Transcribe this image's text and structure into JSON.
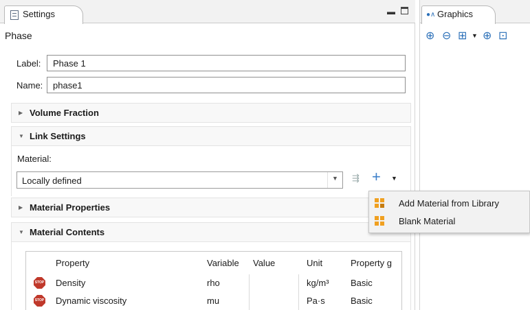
{
  "settings": {
    "tab_label": "Settings",
    "node_title": "Phase",
    "label_field": {
      "label": "Label:",
      "value": "Phase 1"
    },
    "name_field": {
      "label": "Name:",
      "value": "phase1"
    },
    "sections": {
      "volume_fraction": "Volume Fraction",
      "link_settings": "Link Settings",
      "material_properties": "Material Properties",
      "material_contents": "Material Contents"
    },
    "material_label": "Material:",
    "material_value": "Locally defined"
  },
  "table": {
    "headers": [
      "Property",
      "Variable",
      "Value",
      "Unit",
      "Property g"
    ],
    "rows": [
      {
        "status": "STOP",
        "property": "Density",
        "variable": "rho",
        "value": "",
        "unit": "kg/m³",
        "group": "Basic"
      },
      {
        "status": "STOP",
        "property": "Dynamic viscosity",
        "variable": "mu",
        "value": "",
        "unit": "Pa·s",
        "group": "Basic"
      }
    ]
  },
  "graphics": {
    "tab_label": "Graphics"
  },
  "popup_menu": {
    "items": [
      {
        "label": "Add Material from Library",
        "icon": "add-material-library-icon"
      },
      {
        "label": "Blank Material",
        "icon": "blank-material-icon"
      }
    ]
  },
  "colors": {
    "accent": "#2a6fb8",
    "material_icon": "#f0a020",
    "stop": "#c0392b"
  }
}
